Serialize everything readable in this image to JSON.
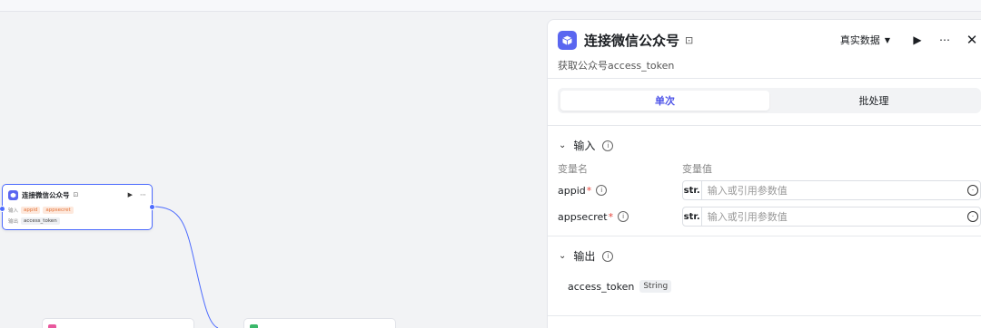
{
  "canvas": {
    "node": {
      "title": "连接微信公众号",
      "input_label": "输入",
      "output_label": "输出",
      "inputs": [
        "appid",
        "appsecret"
      ],
      "output": "access_token"
    }
  },
  "panel": {
    "title": "连接微信公众号",
    "description": "获取公众号access_token",
    "mode_label": "真实数据",
    "tabs": [
      {
        "label": "单次",
        "active": true
      },
      {
        "label": "批处理",
        "active": false
      }
    ],
    "input_section": {
      "title": "输入",
      "col_name": "变量名",
      "col_value": "变量值",
      "rows": [
        {
          "name": "appid",
          "required": "*",
          "type": "str.",
          "placeholder": "输入或引用参数值"
        },
        {
          "name": "appsecret",
          "required": "*",
          "type": "str.",
          "placeholder": "输入或引用参数值"
        }
      ]
    },
    "output_section": {
      "title": "输出",
      "name": "access_token",
      "type": "String"
    }
  },
  "colors": {
    "accent": "#4d53e8",
    "node_icon": "#5a66f0",
    "wire": "#4d6bfe",
    "required": "#e6443b"
  },
  "icons": {
    "node_icon": "cube-icon",
    "title_badge": "lock-icon",
    "run": "play-icon",
    "more": "more-icon",
    "close": "close-icon",
    "collapse": "chevron-down-icon",
    "info": "info-icon",
    "variable": "variable-selector-icon"
  }
}
